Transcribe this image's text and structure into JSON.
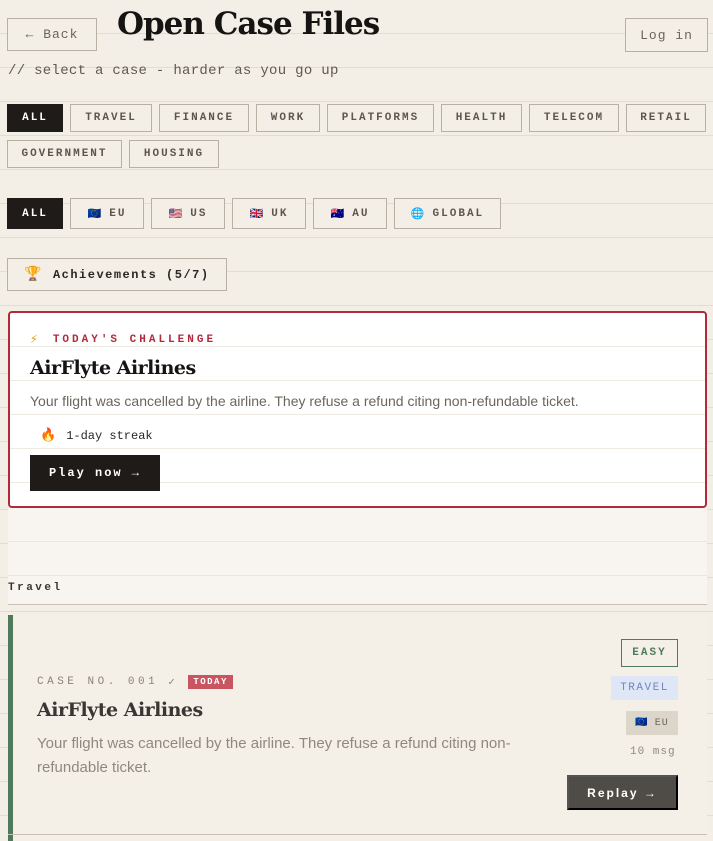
{
  "header": {
    "back_label": "← Back",
    "title": "Open Case Files",
    "login_label": "Log in",
    "subtitle": "// select a case - harder as you go up"
  },
  "category_filters": [
    {
      "label": "ALL",
      "active": true
    },
    {
      "label": "TRAVEL",
      "active": false
    },
    {
      "label": "FINANCE",
      "active": false
    },
    {
      "label": "WORK",
      "active": false
    },
    {
      "label": "PLATFORMS",
      "active": false
    },
    {
      "label": "HEALTH",
      "active": false
    },
    {
      "label": "TELECOM",
      "active": false
    },
    {
      "label": "RETAIL",
      "active": false
    },
    {
      "label": "GOVERNMENT",
      "active": false
    },
    {
      "label": "HOUSING",
      "active": false
    }
  ],
  "region_filters": [
    {
      "label": "ALL",
      "flag": "",
      "active": true
    },
    {
      "label": "EU",
      "flag": "🇪🇺",
      "active": false
    },
    {
      "label": "US",
      "flag": "🇺🇸",
      "active": false
    },
    {
      "label": "UK",
      "flag": "🇬🇧",
      "active": false
    },
    {
      "label": "AU",
      "flag": "🇦🇺",
      "active": false
    },
    {
      "label": "GLOBAL",
      "flag": "🌐",
      "active": false
    }
  ],
  "achievements": {
    "icon": "trophy-icon",
    "label": "Achievements (5/7)"
  },
  "challenge": {
    "icon": "lightning-icon",
    "label": "TODAY'S CHALLENGE",
    "name": "AirFlyte Airlines",
    "description": "Your flight was cancelled by the airline. They refuse a refund citing non-refundable ticket.",
    "streak_icon": "fire-icon",
    "streak": "1-day streak",
    "play_label": "Play now →"
  },
  "section_title": "Travel",
  "cases": [
    {
      "case_no": "CASE NO. 001",
      "check": "✓",
      "today_badge": "TODAY",
      "name": "AirFlyte Airlines",
      "description": "Your flight was cancelled by the airline. They refuse a refund citing non-refundable ticket.",
      "difficulty": "EASY",
      "category": "TRAVEL",
      "region_flag": "🇪🇺",
      "region": "EU",
      "messages": "10 msg",
      "replay_label": "Replay →"
    }
  ],
  "colors": {
    "accent_red": "#b22a3a",
    "easy_green": "#4e7a59",
    "dark": "#1e1b18"
  }
}
